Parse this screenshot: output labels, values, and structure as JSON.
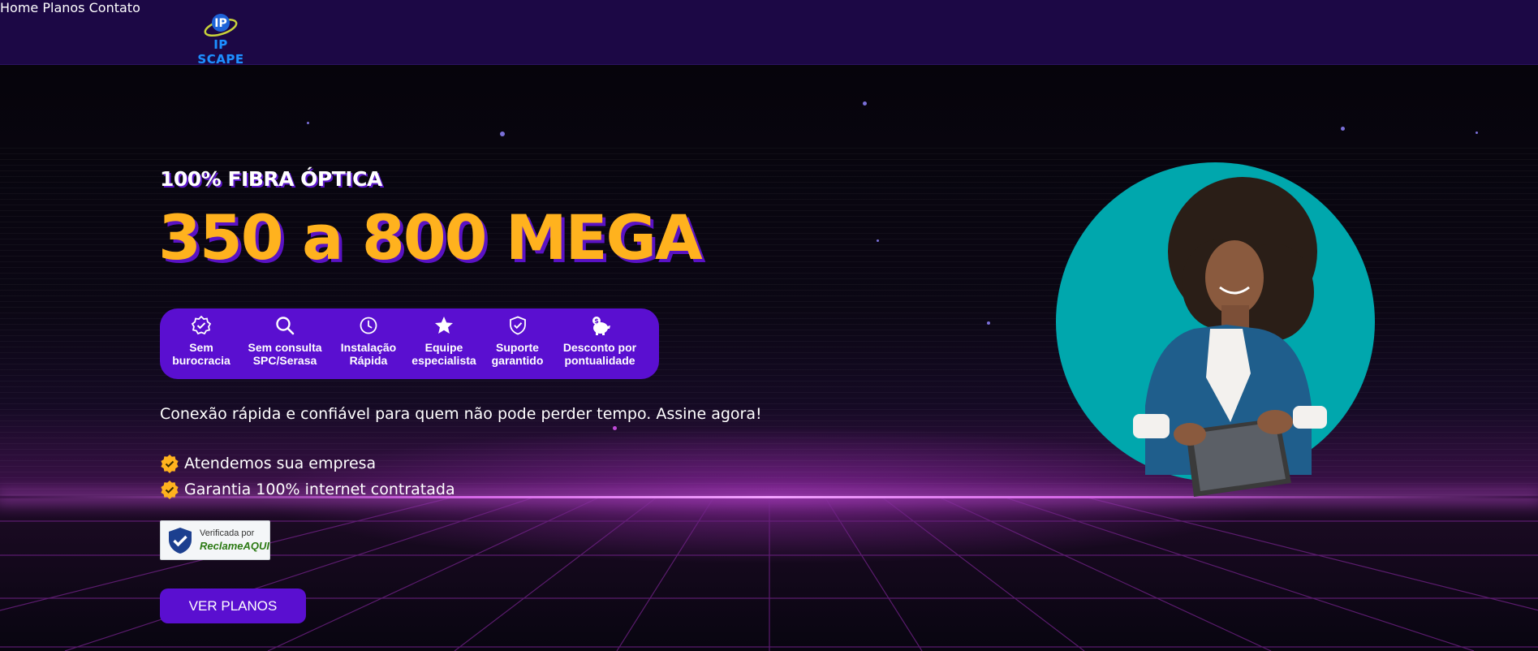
{
  "header": {
    "logo_text": "IP SCAPE",
    "nav": [
      "Home",
      "Planos",
      "Contato"
    ]
  },
  "hero": {
    "kicker": "100% FIBRA ÓPTICA",
    "headline": "350 a 800 MEGA",
    "features": [
      {
        "icon": "verified-badge-icon",
        "line1": "Sem",
        "line2": "burocracia"
      },
      {
        "icon": "search-icon",
        "line1": "Sem consulta",
        "line2": "SPC/Serasa"
      },
      {
        "icon": "clock-icon",
        "line1": "Instalação",
        "line2": "Rápida"
      },
      {
        "icon": "star-icon",
        "line1": "Equipe",
        "line2": "especialista"
      },
      {
        "icon": "shield-check-icon",
        "line1": "Suporte",
        "line2": "garantido"
      },
      {
        "icon": "piggy-bank-icon",
        "line1": "Desconto por",
        "line2": "pontualidade"
      }
    ],
    "tagline": "Conexão rápida e confiável para quem não pode perder tempo. Assine agora!",
    "bullets": [
      "Atendemos sua empresa",
      "Garantia 100% internet contratada"
    ],
    "badge": {
      "small": "Verificada por",
      "brand": "ReclameAQUI"
    },
    "cta_label": "VER PLANOS"
  },
  "colors": {
    "header_bg": "#1c0845",
    "accent_purple": "#5a0fd0",
    "headline_yellow": "#ffb21e",
    "circle_teal": "#00a7ad"
  }
}
